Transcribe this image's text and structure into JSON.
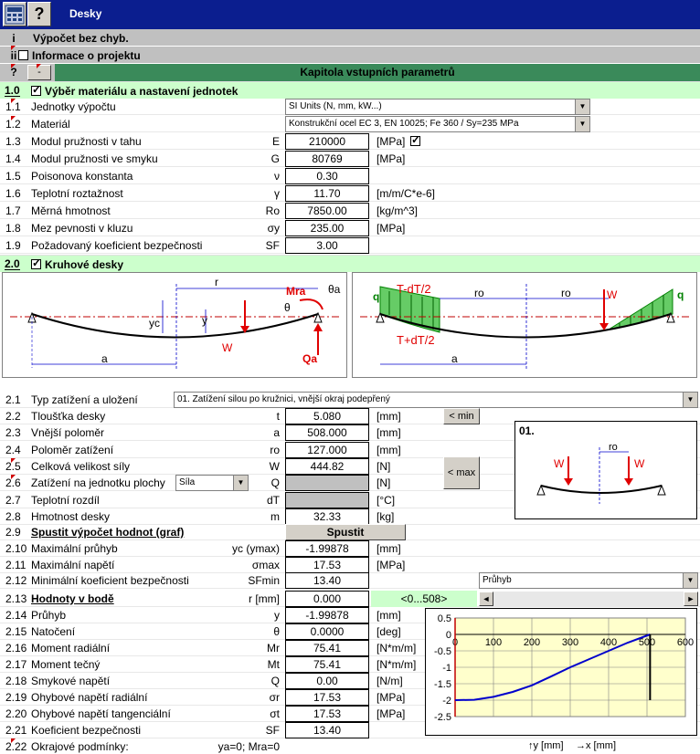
{
  "window": {
    "title": "Desky",
    "help_glyph": "?"
  },
  "sections": {
    "i": {
      "num": "i",
      "label": "Výpočet bez chyb."
    },
    "ii": {
      "num": "ii",
      "label": "Informace o projektu"
    }
  },
  "chapter": {
    "q": "?",
    "minus": "-",
    "title": "Kapitola vstupních parametrů"
  },
  "sec1": {
    "num": "1.0",
    "label": "Výběr materiálu a nastavení jednotek"
  },
  "sec2": {
    "num": "2.0",
    "label": "Kruhové desky"
  },
  "rows1": [
    {
      "n": "1.1",
      "label": "Jednotky výpočtu",
      "combo": "SI Units (N, mm, kW...)"
    },
    {
      "n": "1.2",
      "label": "Materiál",
      "combo": "Konstrukční ocel EC 3, EN 10025; Fe 360 / Sy=235 MPa"
    },
    {
      "n": "1.3",
      "label": "Modul pružnosti v tahu",
      "sym": "E",
      "value": "210000",
      "unit": "[MPa]"
    },
    {
      "n": "1.4",
      "label": "Modul pružnosti ve smyku",
      "sym": "G",
      "value": "80769",
      "unit": "[MPa]"
    },
    {
      "n": "1.5",
      "label": "Poisonova konstanta",
      "sym": "ν",
      "value": "0.30",
      "unit": ""
    },
    {
      "n": "1.6",
      "label": "Teplotní roztažnost",
      "sym": "γ",
      "value": "11.70",
      "unit": "[m/m/C*e-6]"
    },
    {
      "n": "1.7",
      "label": "Měrná hmotnost",
      "sym": "Ro",
      "value": "7850.00",
      "unit": "[kg/m^3]"
    },
    {
      "n": "1.8",
      "label": "Mez pevnosti v kluzu",
      "sym": "σy",
      "value": "235.00",
      "unit": "[MPa]"
    },
    {
      "n": "1.9",
      "label": "Požadovaný koeficient bezpečnosti",
      "sym": "SF",
      "value": "3.00",
      "unit": ""
    }
  ],
  "diagram1": {
    "labels": {
      "r": "r",
      "yc": "yc",
      "y": "y",
      "W": "W",
      "a": "a",
      "Mra": "Mra",
      "theta_a": "θa",
      "theta": "θ",
      "Qa": "Qa"
    }
  },
  "diagram2": {
    "labels": {
      "q_left": "q",
      "q_right": "q",
      "TdT_top": "T-dT/2",
      "TdT_bot": "T+dT/2",
      "ro_left": "ro",
      "ro_right": "ro",
      "W": "W",
      "a": "a"
    }
  },
  "row21": {
    "n": "2.1",
    "label": "Typ zatížení a uložení",
    "combo": "01. Zatížení silou po kružnici, vnější okraj podepřený"
  },
  "rows2": [
    {
      "n": "2.2",
      "label": "Tloušťka desky",
      "sym": "t",
      "value": "5.080",
      "unit": "[mm]"
    },
    {
      "n": "2.3",
      "label": "Vnější poloměr",
      "sym": "a",
      "value": "508.000",
      "unit": "[mm]"
    },
    {
      "n": "2.4",
      "label": "Poloměr zatížení",
      "sym": "ro",
      "value": "127.000",
      "unit": "[mm]"
    },
    {
      "n": "2.5",
      "label": "Celková velikost síly",
      "sym": "W",
      "value": "444.82",
      "unit": "[N]"
    },
    {
      "n": "2.6",
      "label": "Zatížení na jednotku plochy",
      "sym": "Q",
      "value": "",
      "unit": "[N]",
      "grey": true,
      "combo": "Síla"
    },
    {
      "n": "2.7",
      "label": "Teplotní rozdíl",
      "sym": "dT",
      "value": "",
      "unit": "[°C]",
      "grey": true
    },
    {
      "n": "2.8",
      "label": "Hmotnost desky",
      "sym": "m",
      "value": "32.33",
      "unit": "[kg]"
    }
  ],
  "buttons": {
    "min": "< min",
    "max": "< max",
    "run": "Spustit"
  },
  "preview": {
    "label": "01.",
    "W1": "W",
    "W2": "W",
    "ro": "ro"
  },
  "row29": {
    "n": "2.9",
    "label": "Spustit výpočet hodnot (graf)"
  },
  "rows3": [
    {
      "n": "2.10",
      "label": "Maximální průhyb",
      "sym": "yc (ymax)",
      "value": "-1.99878",
      "unit": "[mm]"
    },
    {
      "n": "2.11",
      "label": "Maximální napětí",
      "sym": "σmax",
      "value": "17.53",
      "unit": "[MPa]"
    },
    {
      "n": "2.12",
      "label": "Minimální koeficient bezpečnosti",
      "sym": "SFmin",
      "value": "13.40",
      "unit": ""
    }
  ],
  "graph_select": "Průhyb",
  "row213": {
    "n": "2.13",
    "label": "Hodnoty v bodě",
    "sym": "r [mm]",
    "value": "0.000",
    "range": "<0...508>",
    "scroll_left": "◄",
    "scroll_right": "►"
  },
  "rows4": [
    {
      "n": "2.14",
      "label": "Průhyb",
      "sym": "y",
      "value": "-1.99878",
      "unit": "[mm]"
    },
    {
      "n": "2.15",
      "label": "Natočení",
      "sym": "θ",
      "value": "0.0000",
      "unit": "[deg]"
    },
    {
      "n": "2.16",
      "label": "Moment radiální",
      "sym": "Mr",
      "value": "75.41",
      "unit": "[N*m/m]"
    },
    {
      "n": "2.17",
      "label": "Moment tečný",
      "sym": "Mt",
      "value": "75.41",
      "unit": "[N*m/m]"
    },
    {
      "n": "2.18",
      "label": "Smykové napětí",
      "sym": "Q",
      "value": "0.00",
      "unit": "[N/m]"
    },
    {
      "n": "2.19",
      "label": "Ohybové napětí radiální",
      "sym": "σr",
      "value": "17.53",
      "unit": "[MPa]"
    },
    {
      "n": "2.20",
      "label": "Ohybové napětí tangenciální",
      "sym": "σt",
      "value": "17.53",
      "unit": "[MPa]"
    },
    {
      "n": "2.21",
      "label": "Koeficient bezpečnosti",
      "sym": "SF",
      "value": "13.40",
      "unit": ""
    },
    {
      "n": "2.22",
      "label": "Okrajové podmínky:",
      "sym": "ya=0; Mra=0",
      "value": "",
      "unit": ""
    }
  ],
  "axis_caption": {
    "y": "↑y [mm]",
    "x": "→x [mm]"
  },
  "chart_data": {
    "type": "line",
    "x": [
      0,
      50,
      100,
      150,
      200,
      250,
      300,
      350,
      400,
      450,
      508
    ],
    "y": [
      -2.0,
      -1.99,
      -1.9,
      -1.75,
      -1.55,
      -1.28,
      -1.0,
      -0.75,
      -0.5,
      -0.25,
      0.0
    ],
    "xlim": [
      0,
      600
    ],
    "ylim": [
      -2.5,
      0.5
    ],
    "xticks": [
      "0",
      "100",
      "200",
      "300",
      "400",
      "500",
      "600"
    ],
    "yticks": [
      "0.5",
      "0",
      "-0.5",
      "-1",
      "-1.5",
      "-2",
      "-2.5"
    ],
    "grid": true,
    "line_color": "#0000cc",
    "background": "#ffffcc",
    "marker_x": 508
  }
}
